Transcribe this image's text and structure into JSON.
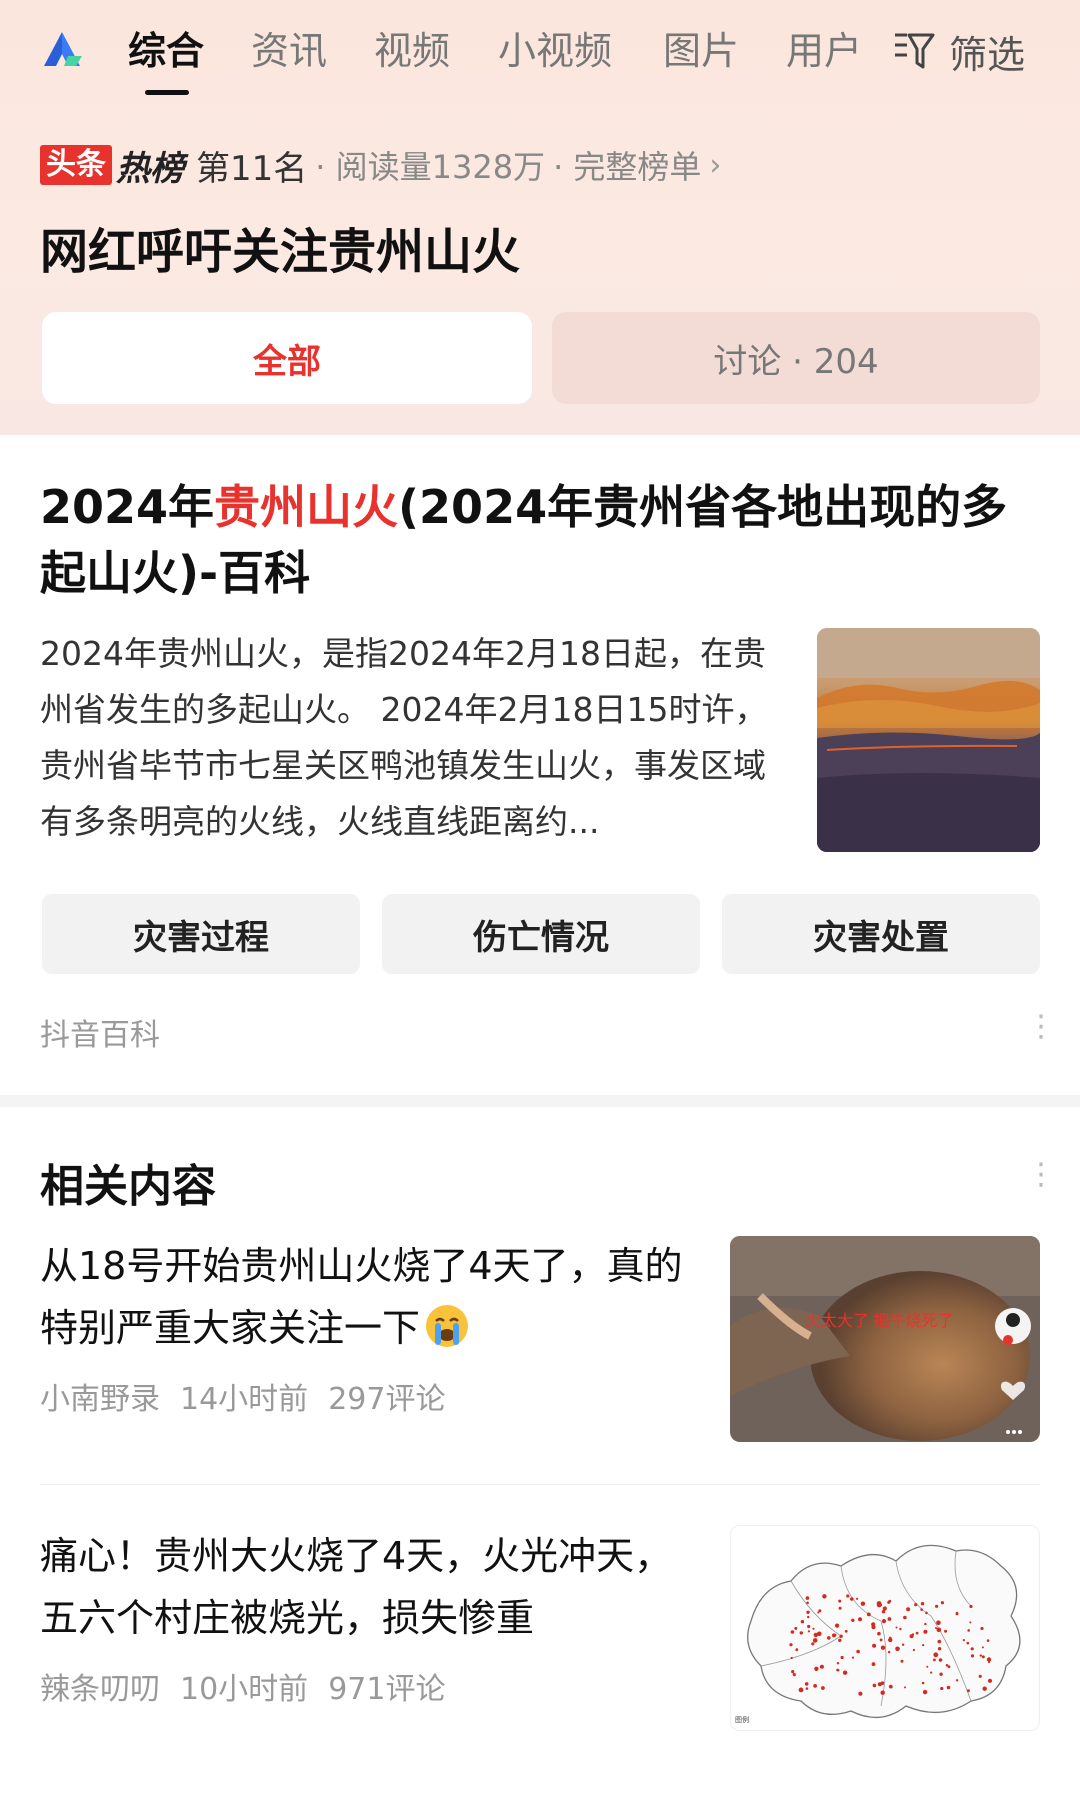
{
  "nav": {
    "tabs": [
      {
        "label": "综合",
        "active": true
      },
      {
        "label": "资讯",
        "active": false
      },
      {
        "label": "视频",
        "active": false
      },
      {
        "label": "小视频",
        "active": false
      },
      {
        "label": "图片",
        "active": false
      },
      {
        "label": "用户",
        "active": false
      }
    ],
    "filter_label": "筛选",
    "logo_icon": "app-logo-icon",
    "filter_icon": "filter-icon"
  },
  "hot": {
    "badge_toutiao": "头条",
    "badge_hot": "热榜",
    "rank": "第11名",
    "reads": "· 阅读量1328万",
    "full_list": "· 完整榜单",
    "chevron": "›"
  },
  "headline": "网红呼吁关注贵州山火",
  "segments": {
    "all": "全部",
    "discussion": "讨论 · 204"
  },
  "baike": {
    "title_prefix": "2024年",
    "title_highlight": "贵州山火",
    "title_suffix": "(2024年贵州省各地出现的多起山火)-百科",
    "description": "2024年贵州山火，是指2024年2月18日起，在贵州省发生的多起山火。 2024年2月18日15时许，贵州省毕节市七星关区鸭池镇发生山火，事发区域有多条明亮的火线，火线直线距离约...",
    "chips": [
      "灾害过程",
      "伤亡情况",
      "灾害处置"
    ],
    "source": "抖音百科",
    "more": "⋮"
  },
  "related": {
    "title": "相关内容",
    "more": "⋮",
    "items": [
      {
        "title": "从18号开始贵州山火烧了4天了，真的特别严重大家关注一下",
        "author": "小南野录",
        "time": "14小时前",
        "comments": "297评论",
        "thumb_caption": "火太大了 把牛烧死了"
      },
      {
        "title": "痛心！贵州大火烧了4天，火光冲天，五六个村庄被烧光，损失惨重",
        "author": "辣条叨叨",
        "time": "10小时前",
        "comments": "971评论"
      }
    ]
  },
  "colors": {
    "accent": "#e8322d",
    "header_bg": "#fbe6dd"
  }
}
